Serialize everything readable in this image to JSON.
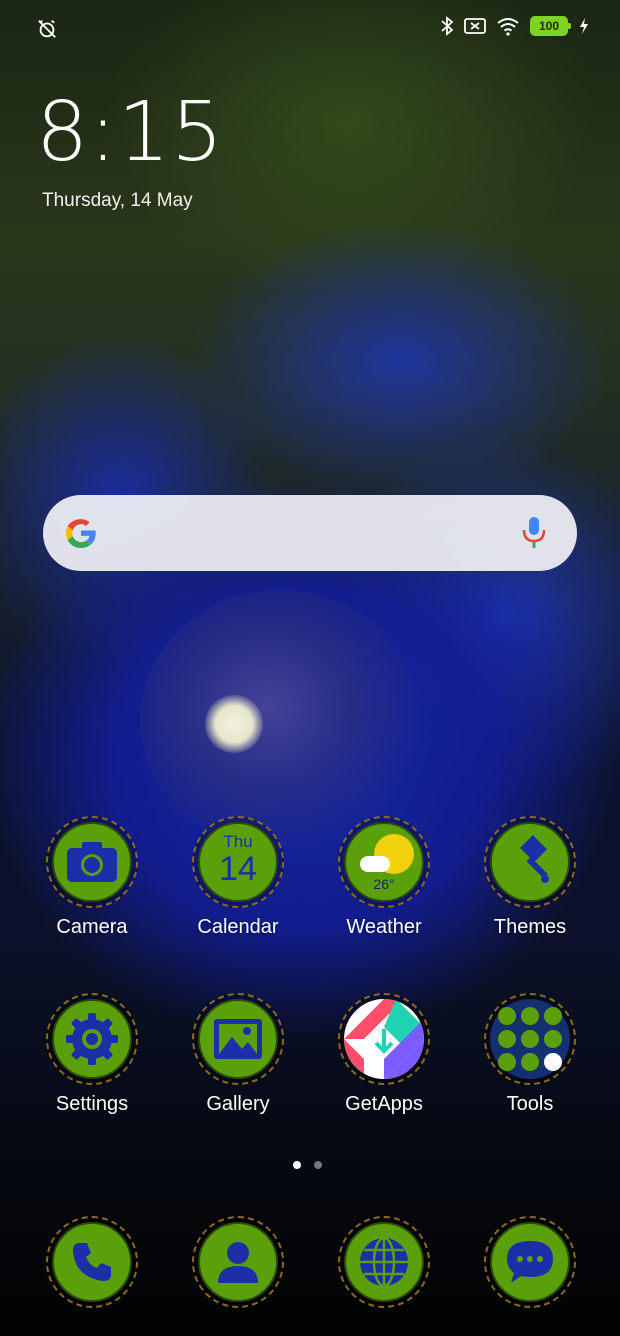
{
  "status_bar": {
    "battery_level": "100",
    "icons": [
      "alarm-off-icon",
      "bluetooth-icon",
      "no-sim-icon",
      "wifi-icon",
      "battery-icon",
      "charging-icon"
    ]
  },
  "lockscreen": {
    "time": "8:15",
    "date": "Thursday, 14 May"
  },
  "search": {
    "brand_icon": "google-g-icon",
    "voice_icon": "mic-icon"
  },
  "apps": [
    {
      "label": "Camera"
    },
    {
      "label": "Calendar",
      "day": "Thu",
      "date": "14"
    },
    {
      "label": "Weather",
      "temp": "26°"
    },
    {
      "label": "Themes"
    },
    {
      "label": "Settings"
    },
    {
      "label": "Gallery"
    },
    {
      "label": "GetApps"
    },
    {
      "label": "Tools"
    }
  ],
  "dock": [
    {
      "name": "phone"
    },
    {
      "name": "contacts"
    },
    {
      "name": "browser"
    },
    {
      "name": "messages"
    }
  ],
  "pages": {
    "count": 2,
    "active": 0
  },
  "colors": {
    "icon_green": "#5aa00a",
    "icon_blue": "#1c2fa8",
    "battery_green": "#7dd321"
  }
}
